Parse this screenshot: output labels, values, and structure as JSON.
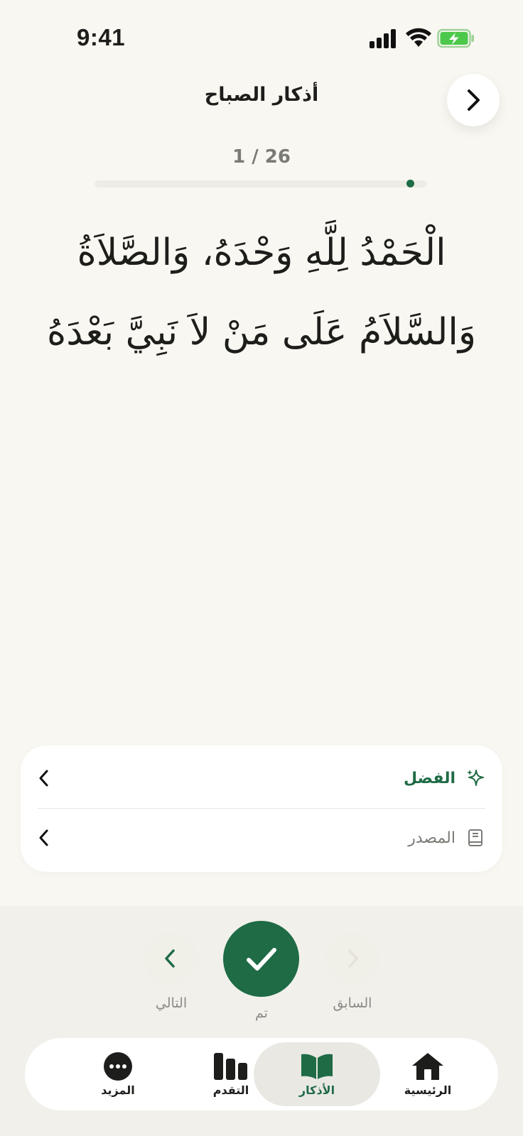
{
  "status_bar": {
    "time": "9:41"
  },
  "header": {
    "title": "أذكار الصباح",
    "back_icon": "chevron-right-icon"
  },
  "progress": {
    "counter_text": "1 / 26",
    "current": 1,
    "total": 26,
    "fraction": 0.04
  },
  "dhikr": {
    "text": "الْحَمْدُ لِلَّهِ وَحْدَهُ، وَالصَّلاَةُ وَالسَّلاَمُ عَلَى مَنْ لاَ نَبِيَّ بَعْدَهُ"
  },
  "info_card": {
    "items": [
      {
        "label": "الفضل",
        "icon": "sparkles-icon",
        "color": "#1e6b45"
      },
      {
        "label": "المصدر",
        "icon": "book-icon",
        "color": "#7a7a76"
      }
    ]
  },
  "controls": {
    "next_label": "التالي",
    "done_label": "تم",
    "previous_label": "السابق"
  },
  "tab_bar": {
    "tabs": [
      {
        "label": "المزيد",
        "icon": "more-icon",
        "active": false
      },
      {
        "label": "التقدم",
        "icon": "bar-chart-icon",
        "active": false
      },
      {
        "label": "الأذكار",
        "icon": "open-book-icon",
        "active": true
      },
      {
        "label": "الرئيسية",
        "icon": "home-icon",
        "active": false
      }
    ]
  },
  "colors": {
    "accent": "#1e6b45",
    "background": "#f9f7f1",
    "text": "#1d1d1b"
  }
}
